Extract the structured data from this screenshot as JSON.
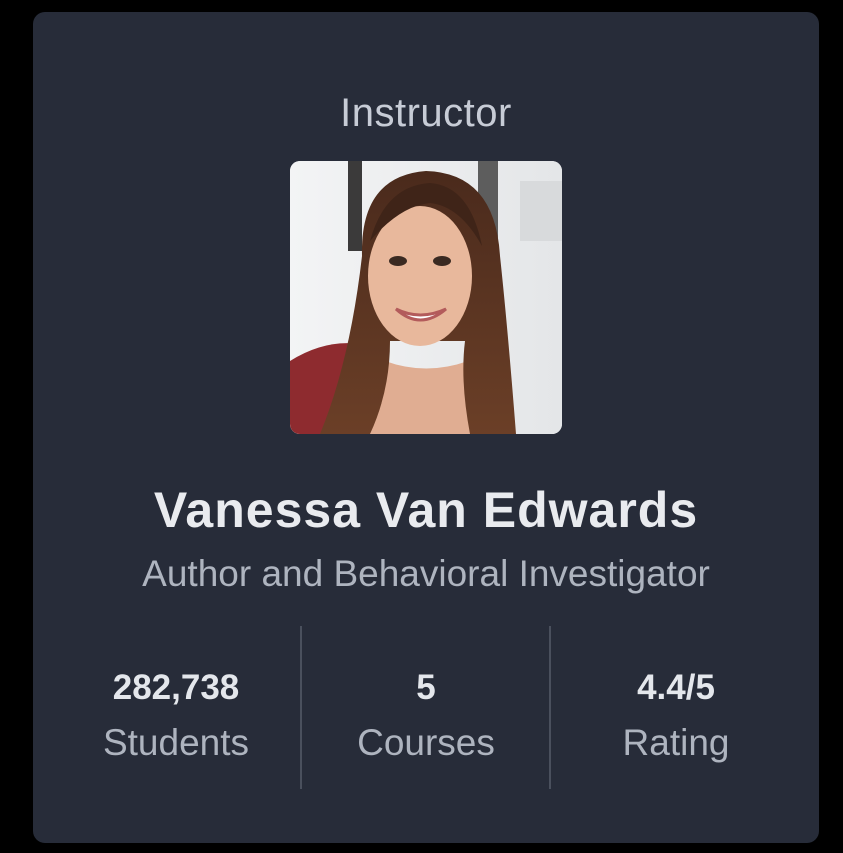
{
  "card": {
    "section_title": "Instructor",
    "instructor": {
      "name": "Vanessa Van Edwards",
      "title": "Author and Behavioral Investigator",
      "photo_icon": "instructor-portrait-photo"
    },
    "stats": [
      {
        "value": "282,738",
        "label": "Students"
      },
      {
        "value": "5",
        "label": "Courses"
      },
      {
        "value": "4.4/5",
        "label": "Rating"
      }
    ]
  },
  "colors": {
    "page_background": "#000000",
    "card_background": "#272c39",
    "primary_text": "#e9ebef",
    "secondary_text": "#aeb4bf",
    "divider": "#4a505d"
  }
}
